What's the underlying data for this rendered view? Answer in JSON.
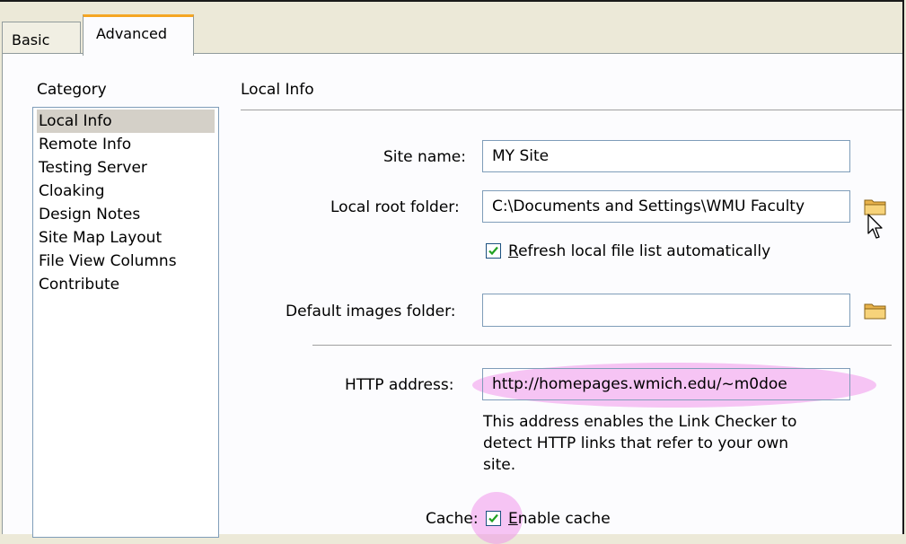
{
  "tabs": {
    "basic": "Basic",
    "advanced": "Advanced"
  },
  "category": {
    "heading": "Category",
    "items": [
      "Local Info",
      "Remote Info",
      "Testing Server",
      "Cloaking",
      "Design Notes",
      "Site Map Layout",
      "File View Columns",
      "Contribute"
    ],
    "selected": "Local Info"
  },
  "section_title": "Local Info",
  "form": {
    "site_name_label": "Site name:",
    "site_name_value": "MY Site",
    "local_root_label": "Local root folder:",
    "local_root_value": "C:\\Documents and Settings\\WMU Faculty",
    "refresh_label_underlined": "R",
    "refresh_label_rest": "efresh local file list automatically",
    "refresh_checked": true,
    "default_images_label": "Default images folder:",
    "default_images_value": "",
    "http_label": "HTTP address:",
    "http_value": "http://homepages.wmich.edu/~m0doe",
    "http_info": [
      "This address enables the Link Checker to",
      "detect HTTP links that refer to your own",
      "site."
    ],
    "cache_label": "Cache:",
    "cache_option_underlined": "E",
    "cache_option_rest": "nable cache",
    "cache_checked": true
  },
  "icons": {
    "folder": "folder-icon",
    "cursor": "mouse-pointer-icon",
    "check": "checkmark-icon"
  },
  "colors": {
    "highlight": "#f096eb",
    "tab_accent": "#f5a623"
  }
}
